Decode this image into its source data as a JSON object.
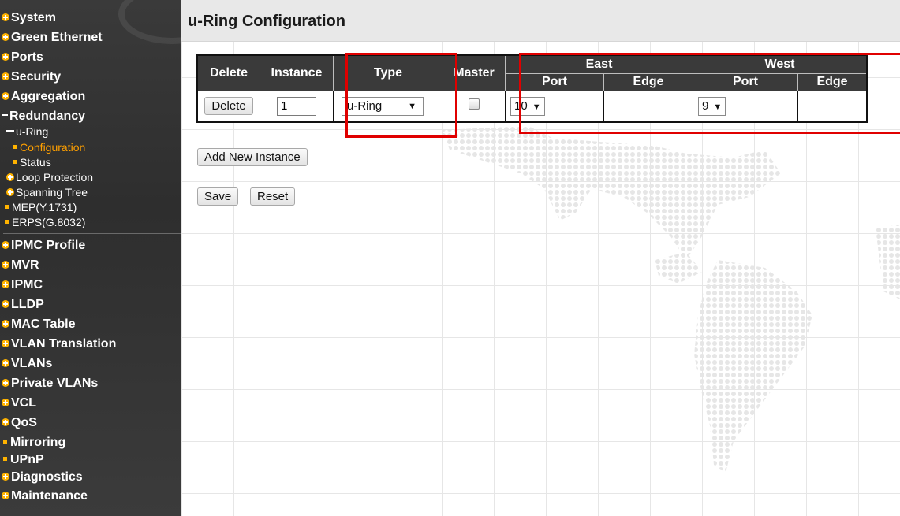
{
  "sidebar": {
    "items": [
      {
        "label": "System"
      },
      {
        "label": "Green Ethernet"
      },
      {
        "label": "Ports"
      },
      {
        "label": "Security"
      },
      {
        "label": "Aggregation"
      },
      {
        "label": "Redundancy"
      },
      {
        "label": "u-Ring"
      },
      {
        "label": "Configuration"
      },
      {
        "label": "Status"
      },
      {
        "label": "Loop Protection"
      },
      {
        "label": "Spanning Tree"
      },
      {
        "label": "MEP(Y.1731)"
      },
      {
        "label": "ERPS(G.8032)"
      },
      {
        "label": "IPMC Profile"
      },
      {
        "label": "MVR"
      },
      {
        "label": "IPMC"
      },
      {
        "label": "LLDP"
      },
      {
        "label": "MAC Table"
      },
      {
        "label": "VLAN Translation"
      },
      {
        "label": "VLANs"
      },
      {
        "label": "Private VLANs"
      },
      {
        "label": "VCL"
      },
      {
        "label": "QoS"
      },
      {
        "label": "Mirroring"
      },
      {
        "label": "UPnP"
      },
      {
        "label": "Diagnostics"
      },
      {
        "label": "Maintenance"
      }
    ]
  },
  "main": {
    "title": "u-Ring Configuration",
    "table": {
      "headers": {
        "delete": "Delete",
        "instance": "Instance",
        "type": "Type",
        "master": "Master",
        "east": "East",
        "west": "West",
        "east_port": "Port",
        "east_edge": "Edge",
        "west_port": "Port",
        "west_edge": "Edge"
      },
      "rows": [
        {
          "delete_label": "Delete",
          "instance": "1",
          "type": "u-Ring",
          "master": false,
          "east_port": "10",
          "west_port": "9"
        }
      ]
    },
    "add_instance_label": "Add New Instance",
    "save_label": "Save",
    "reset_label": "Reset"
  },
  "colors": {
    "sidebar_bg": "#333333",
    "accent_orange": "#ffa000",
    "header_bg": "#3a3a3a",
    "highlight_red": "#e00000"
  },
  "icons": {
    "expand": "plus-circle-icon",
    "collapse": "minus-icon",
    "leaf": "orange-square-icon",
    "dropdown": "caret-down-icon"
  }
}
